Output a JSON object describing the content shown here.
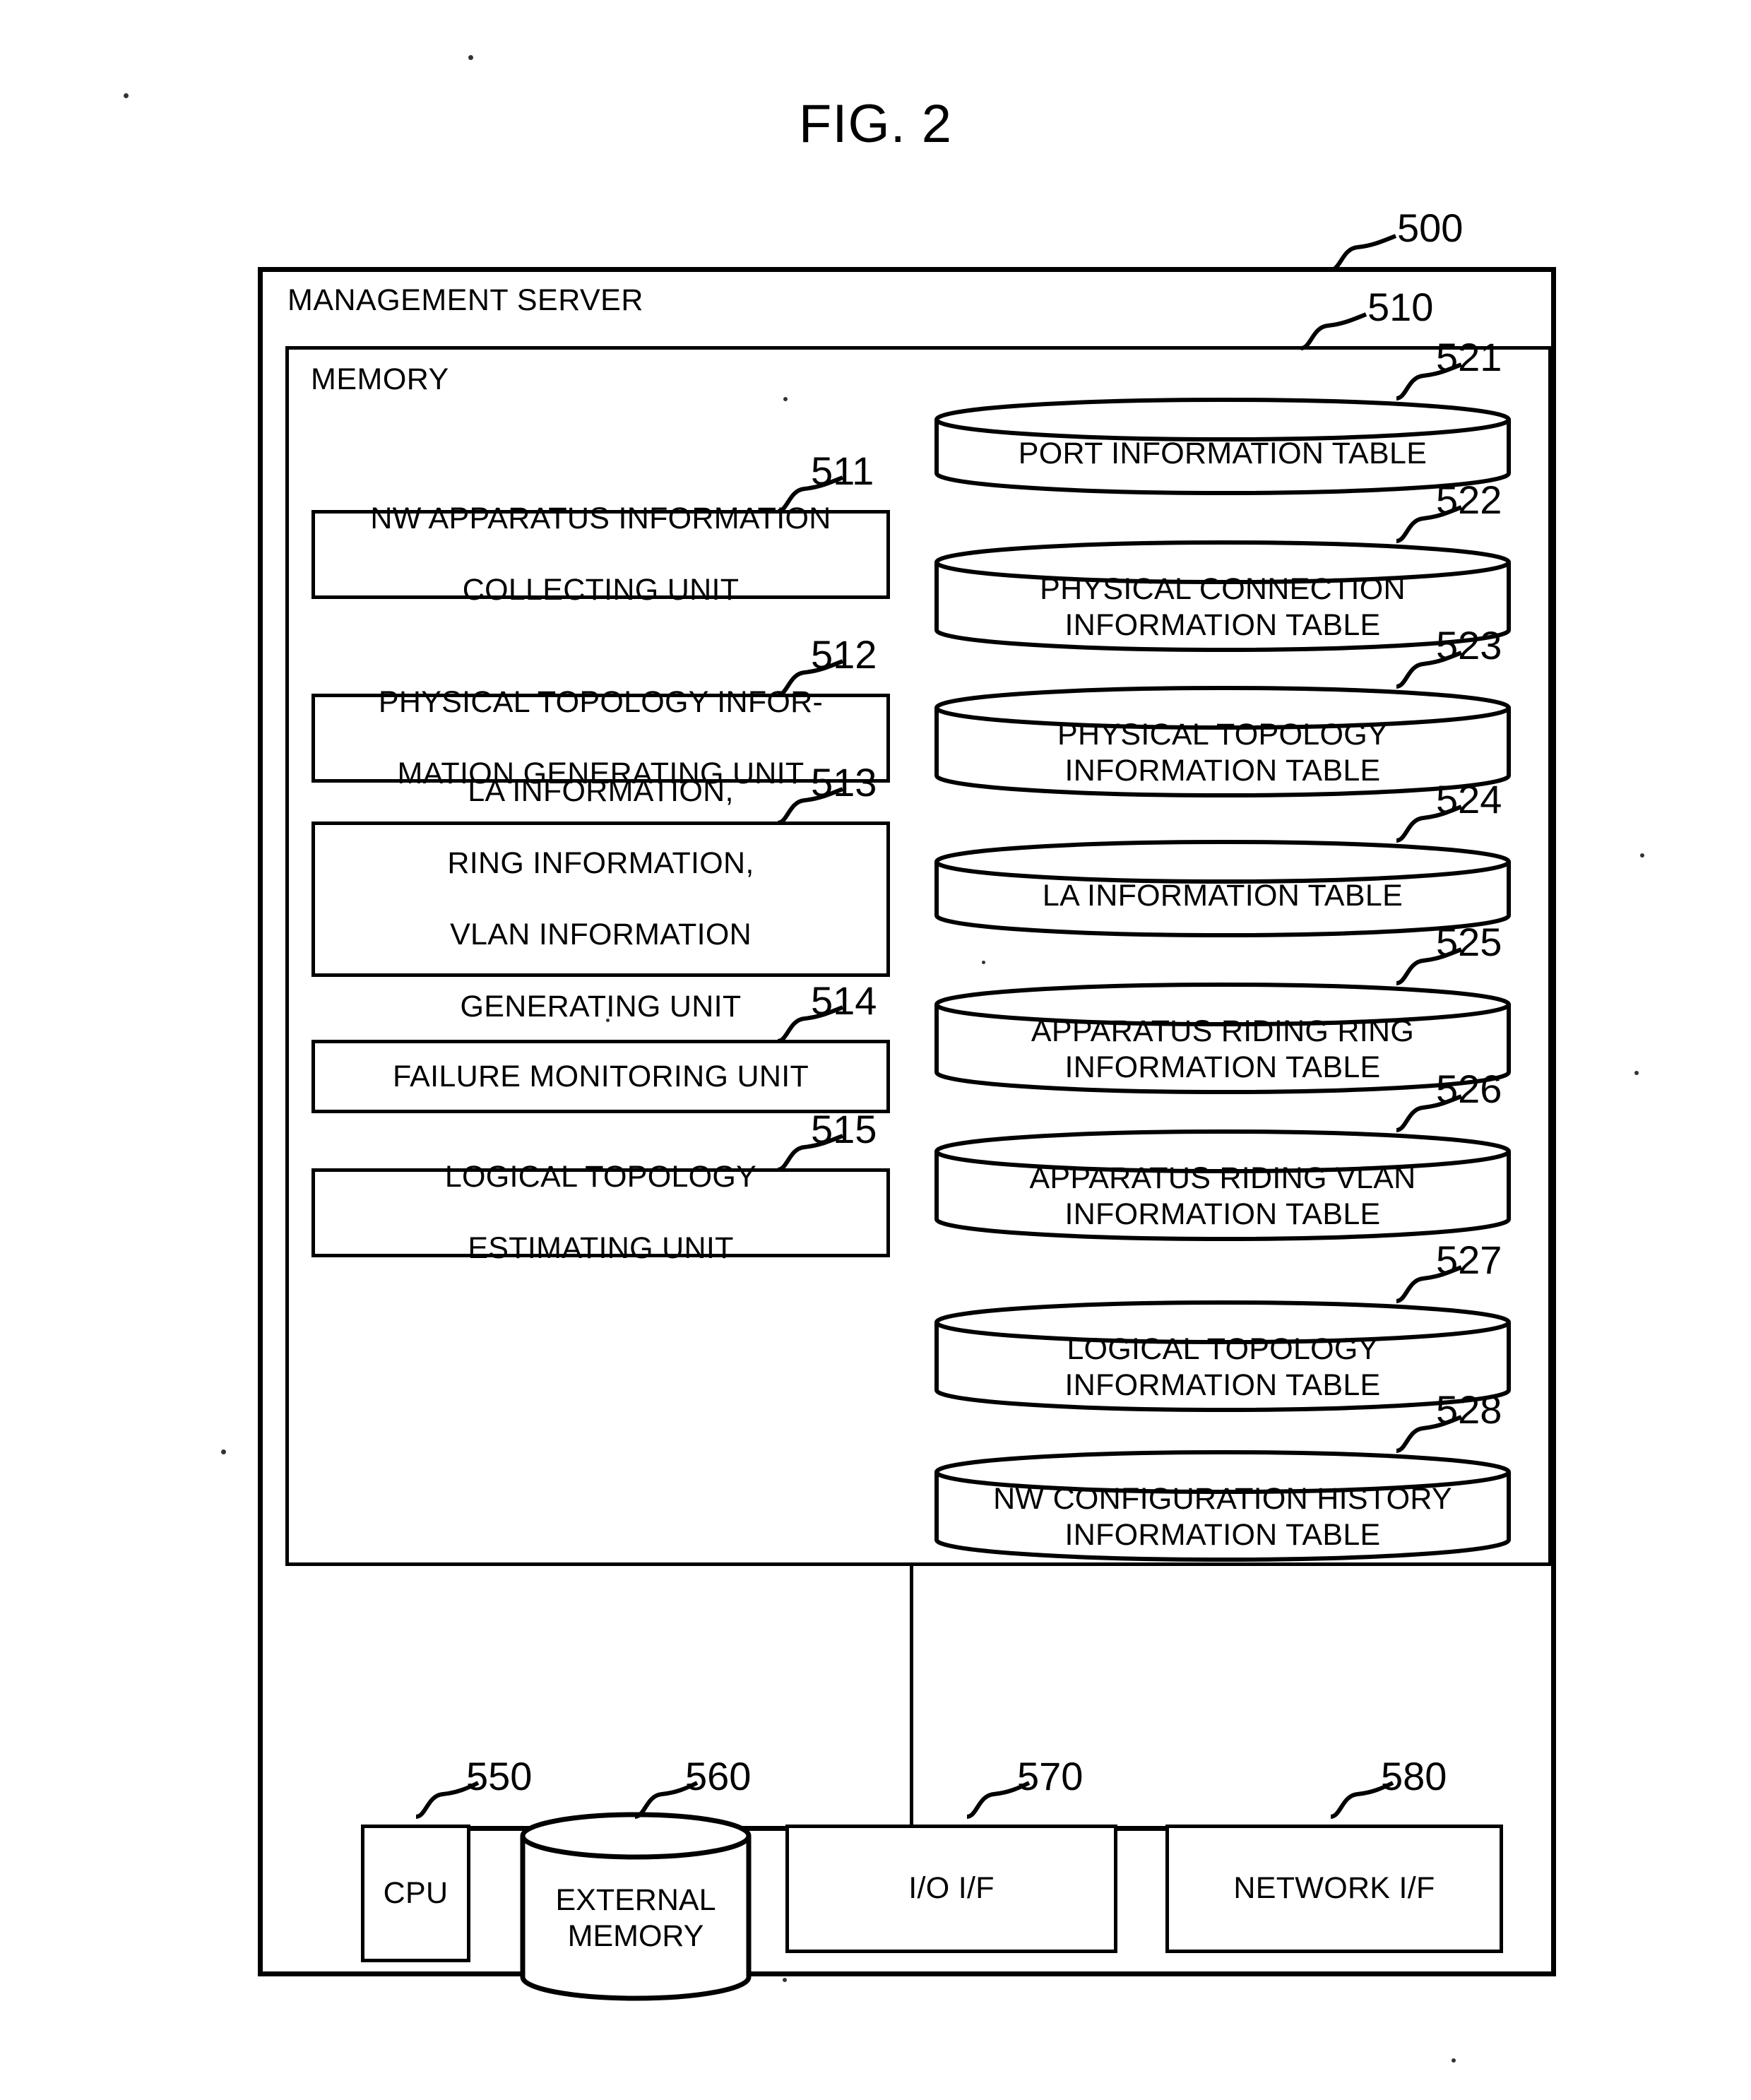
{
  "figure": {
    "title": "FIG. 2"
  },
  "outer": {
    "label": "MANAGEMENT SERVER",
    "ref": "500"
  },
  "memory": {
    "label": "MEMORY",
    "ref": "510"
  },
  "units": [
    {
      "ref": "511",
      "lines": [
        "NW APPARATUS INFORMATION",
        "COLLECTING UNIT"
      ]
    },
    {
      "ref": "512",
      "lines": [
        "PHYSICAL TOPOLOGY INFOR-",
        "MATION GENERATING UNIT"
      ]
    },
    {
      "ref": "513",
      "lines": [
        "LA INFORMATION,",
        "RING INFORMATION,",
        "VLAN INFORMATION",
        "GENERATING UNIT"
      ]
    },
    {
      "ref": "514",
      "lines": [
        "FAILURE MONITORING UNIT"
      ]
    },
    {
      "ref": "515",
      "lines": [
        "LOGICAL TOPOLOGY",
        "ESTIMATING UNIT"
      ]
    }
  ],
  "tables": [
    {
      "ref": "521",
      "lines": [
        "PORT INFORMATION TABLE"
      ]
    },
    {
      "ref": "522",
      "lines": [
        "PHYSICAL CONNECTION",
        "INFORMATION TABLE"
      ]
    },
    {
      "ref": "523",
      "lines": [
        "PHYSICAL TOPOLOGY",
        "INFORMATION TABLE"
      ]
    },
    {
      "ref": "524",
      "lines": [
        "LA INFORMATION TABLE"
      ]
    },
    {
      "ref": "525",
      "lines": [
        "APPARATUS RIDING RING",
        "INFORMATION TABLE"
      ]
    },
    {
      "ref": "526",
      "lines": [
        "APPARATUS RIDING VLAN",
        "INFORMATION TABLE"
      ]
    },
    {
      "ref": "527",
      "lines": [
        "LOGICAL TOPOLOGY",
        "INFORMATION TABLE"
      ]
    },
    {
      "ref": "528",
      "lines": [
        "NW CONFIGURATION HISTORY",
        "INFORMATION TABLE"
      ]
    }
  ],
  "components": [
    {
      "ref": "550",
      "lines": [
        "CPU"
      ],
      "shape": "box"
    },
    {
      "ref": "560",
      "lines": [
        "EXTERNAL",
        "MEMORY"
      ],
      "shape": "cylinder"
    },
    {
      "ref": "570",
      "lines": [
        "I/O I/F"
      ],
      "shape": "box"
    },
    {
      "ref": "580",
      "lines": [
        "NETWORK I/F"
      ],
      "shape": "box"
    }
  ],
  "colors": {
    "ink": "#000000",
    "paper": "#ffffff"
  }
}
